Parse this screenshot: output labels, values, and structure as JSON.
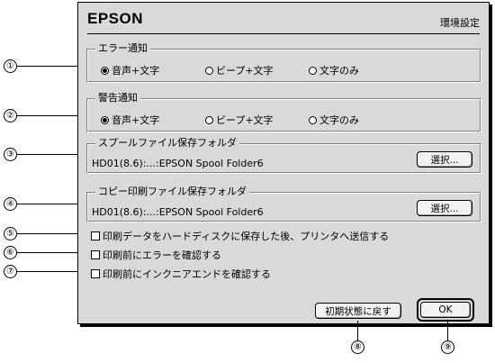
{
  "dialog": {
    "brand": "EPSON",
    "title": "環境設定"
  },
  "groups": {
    "error": {
      "label": "エラー通知",
      "options": [
        "音声+文字",
        "ビープ+文字",
        "文字のみ"
      ],
      "selected": "音声+文字"
    },
    "warning": {
      "label": "警告通知",
      "options": [
        "音声+文字",
        "ビープ+文字",
        "文字のみ"
      ],
      "selected": "音声+文字"
    },
    "spool": {
      "label": "スプールファイル保存フォルダ",
      "path": "HD01(8.6):...:EPSON Spool Folder6",
      "button": "選択..."
    },
    "copy": {
      "label": "コピー印刷ファイル保存フォルダ",
      "path": "HD01(8.6):...:EPSON Spool Folder6",
      "button": "選択..."
    }
  },
  "checks": [
    {
      "label": "印刷データをハードディスクに保存した後、プリンタへ送信する",
      "checked": false
    },
    {
      "label": "印刷前にエラーを確認する",
      "checked": false
    },
    {
      "label": "印刷前にインクニアエンドを確認する",
      "checked": false
    }
  ],
  "buttons": {
    "reset": "初期状態に戻す",
    "ok": "OK"
  },
  "callouts": [
    "①",
    "②",
    "③",
    "④",
    "⑤",
    "⑥",
    "⑦",
    "⑧",
    "⑨"
  ]
}
